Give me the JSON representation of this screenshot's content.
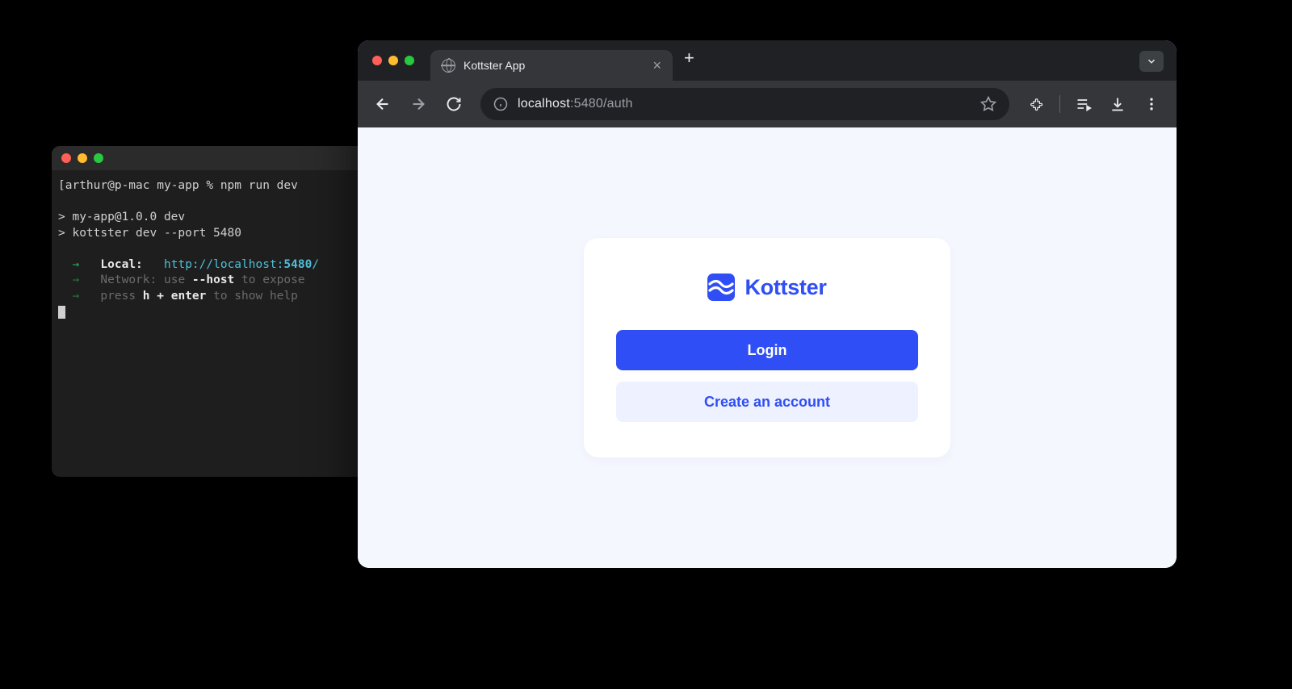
{
  "terminal": {
    "prompt_user": "arthur@p-mac",
    "prompt_dir": "my-app",
    "prompt_symbol": "%",
    "command": "npm run dev",
    "script_line1": "> my-app@1.0.0 dev",
    "script_line2": "> kottster dev --port 5480",
    "local_label": "Local:",
    "local_url_prefix": "http://localhost:",
    "local_port": "5480",
    "local_url_suffix": "/",
    "network_label": "Network:",
    "network_hint_pre": "use ",
    "network_flag": "--host",
    "network_hint_post": " to expose",
    "help_pre": "press ",
    "help_keys": "h + enter",
    "help_post": " to show help"
  },
  "browser": {
    "tab_title": "Kottster App",
    "url_host": "localhost",
    "url_port": ":5480",
    "url_path": "/auth"
  },
  "auth": {
    "brand": "Kottster",
    "login_label": "Login",
    "create_label": "Create an account"
  },
  "colors": {
    "accent": "#2f4ef5"
  }
}
